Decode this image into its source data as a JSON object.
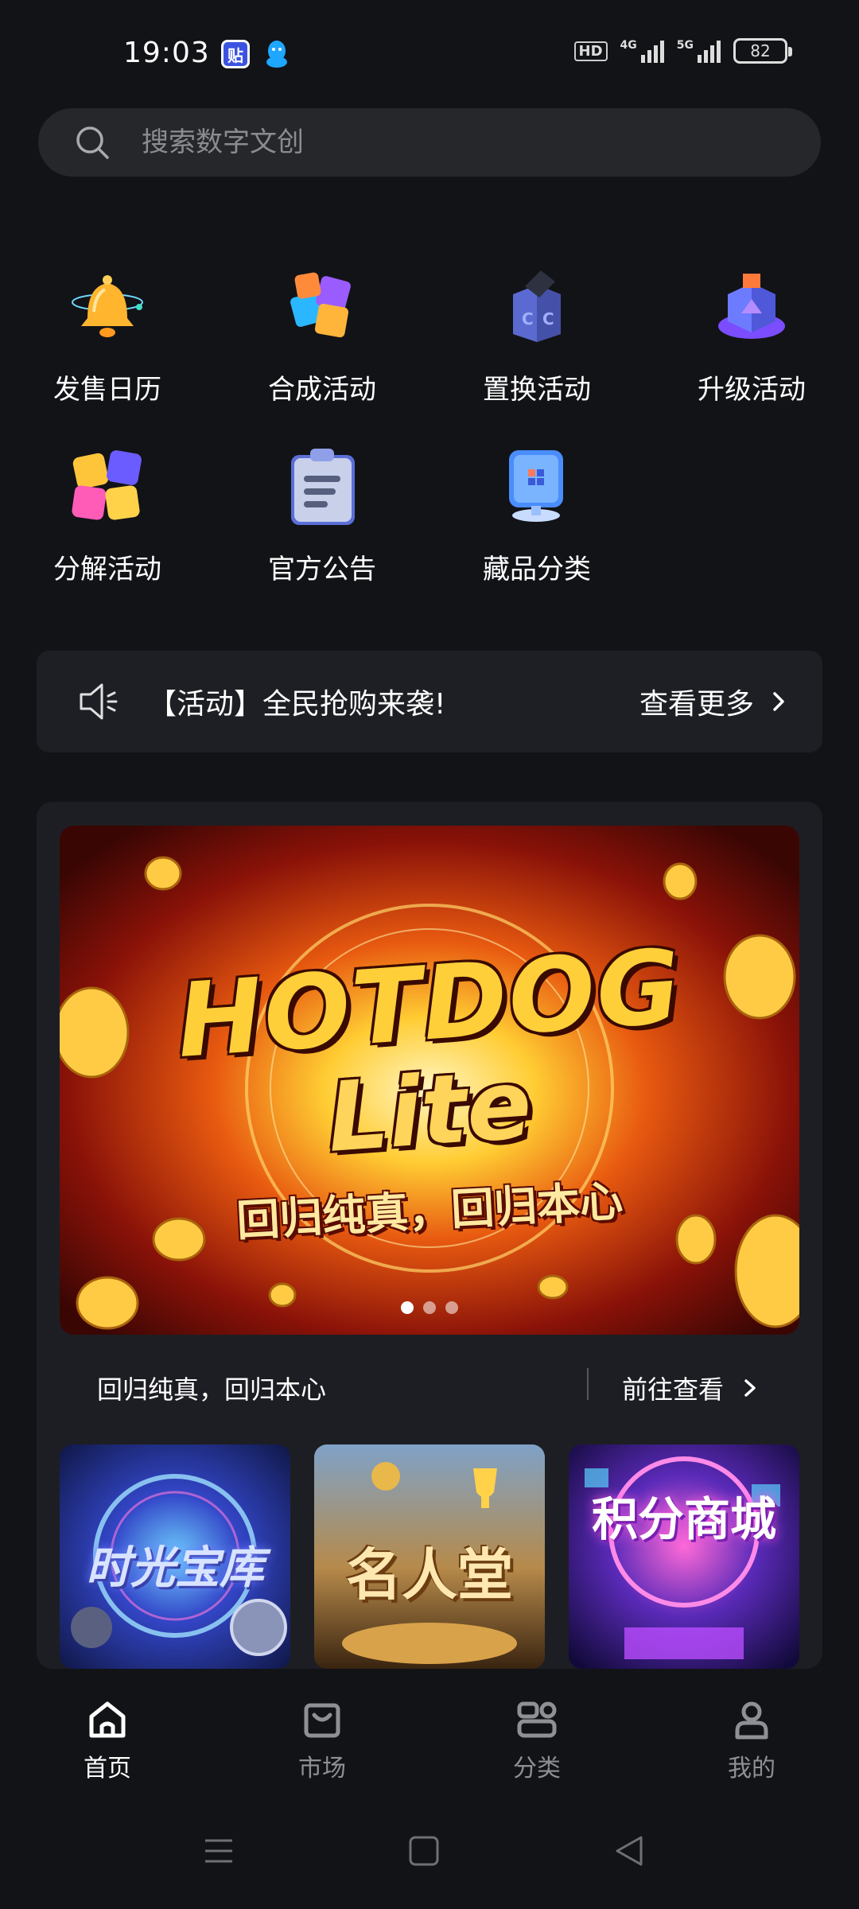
{
  "status_bar": {
    "time": "19:03",
    "app_badge_1": "贴",
    "hd": "HD",
    "net1": "4G",
    "net2": "5G",
    "battery": "82"
  },
  "search": {
    "placeholder": "搜索数字文创"
  },
  "quick_actions": [
    {
      "label": "发售日历",
      "icon": "bell-icon"
    },
    {
      "label": "合成活动",
      "icon": "puzzle-icon"
    },
    {
      "label": "置换活动",
      "icon": "exchange-box-icon"
    },
    {
      "label": "升级活动",
      "icon": "upgrade-cube-icon"
    },
    {
      "label": "分解活动",
      "icon": "decompose-puzzle-icon"
    },
    {
      "label": "官方公告",
      "icon": "clipboard-icon"
    },
    {
      "label": "藏品分类",
      "icon": "category-display-icon"
    }
  ],
  "notice": {
    "text": "【活动】全民抢购来袭!",
    "more": "查看更多"
  },
  "featured": {
    "banner_title_1": "HOTDOG",
    "banner_title_2": "Lite",
    "banner_subtitle": "回归纯真，回归本心",
    "carousel_index": 1,
    "carousel_count": 3,
    "caption": "回归纯真，回归本心",
    "link": "前往查看",
    "tiles": [
      {
        "label": "时光宝库"
      },
      {
        "label": "名人堂"
      },
      {
        "label": "积分商城"
      }
    ]
  },
  "bottom_nav": [
    {
      "label": "首页",
      "icon": "home-icon",
      "active": true
    },
    {
      "label": "市场",
      "icon": "bag-icon",
      "active": false
    },
    {
      "label": "分类",
      "icon": "category-icon",
      "active": false
    },
    {
      "label": "我的",
      "icon": "profile-icon",
      "active": false
    }
  ],
  "colors": {
    "background": "#121317",
    "surface": "#1e1f24",
    "search_bg": "#26272b",
    "inactive_nav": "#8e9095"
  }
}
